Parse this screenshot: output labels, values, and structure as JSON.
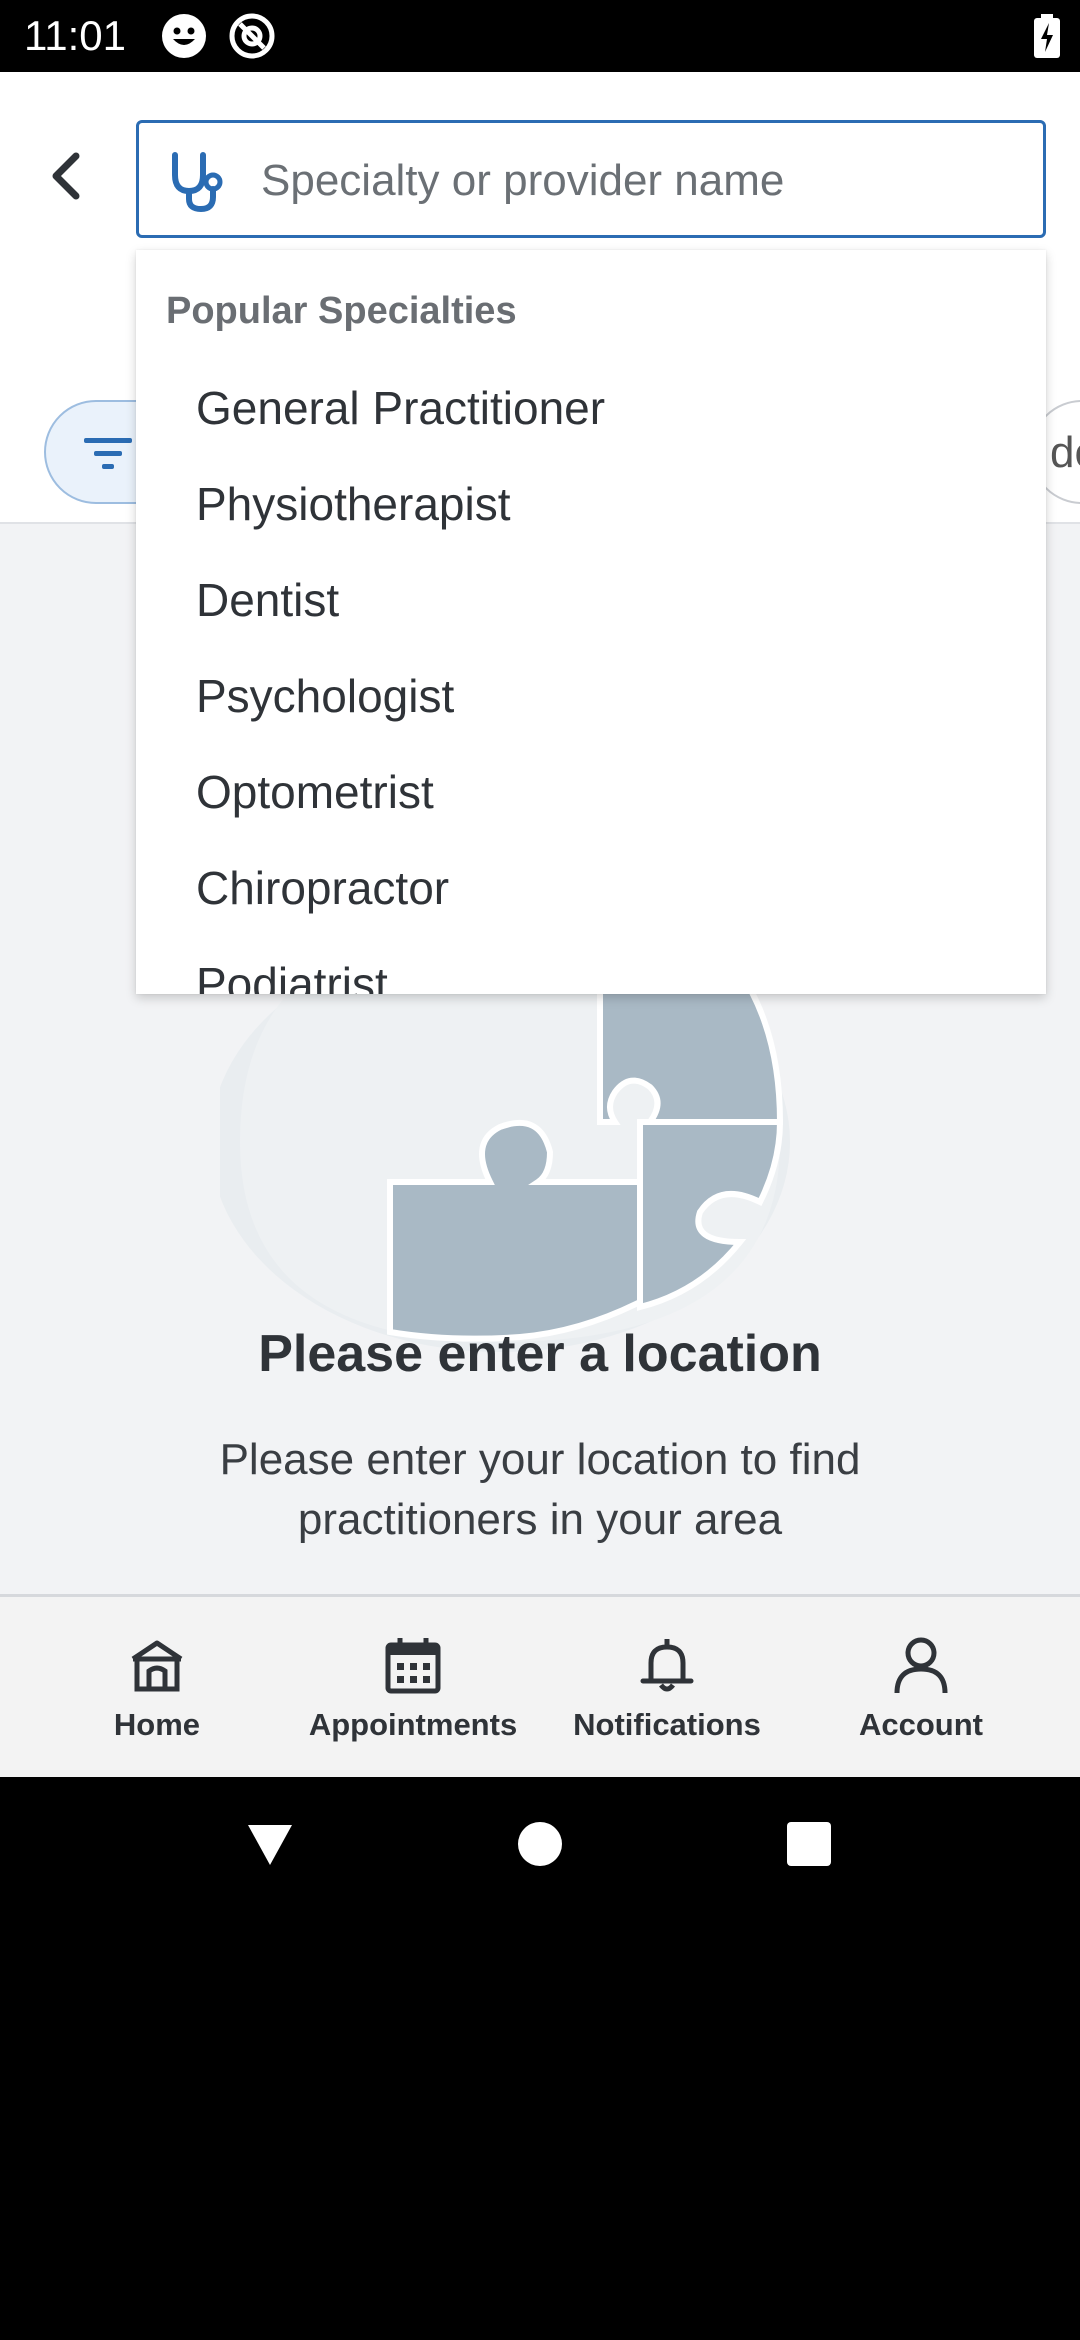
{
  "status_bar": {
    "time": "11:01",
    "icons": [
      "smiley-icon",
      "at-sign-icon",
      "battery-charging-icon"
    ]
  },
  "search": {
    "placeholder": "Specialty or provider name",
    "value": ""
  },
  "filters": {
    "right_pill_partial_text": "de"
  },
  "dropdown": {
    "heading": "Popular Specialties",
    "items": [
      "General Practitioner",
      "Physiotherapist",
      "Dentist",
      "Psychologist",
      "Optometrist",
      "Chiropractor",
      "Podiatrist"
    ]
  },
  "empty_state": {
    "title": "Please enter a location",
    "message": "Please enter your location to find practitioners in your area"
  },
  "bottom_nav": {
    "items": [
      {
        "label": "Home",
        "icon": "home-icon"
      },
      {
        "label": "Appointments",
        "icon": "calendar-icon"
      },
      {
        "label": "Notifications",
        "icon": "bell-icon"
      },
      {
        "label": "Account",
        "icon": "person-icon"
      }
    ]
  },
  "colors": {
    "accent": "#2b6cb3",
    "background": "#f2f3f5",
    "text": "#2f3338",
    "illustration": "#a9b9c5"
  }
}
